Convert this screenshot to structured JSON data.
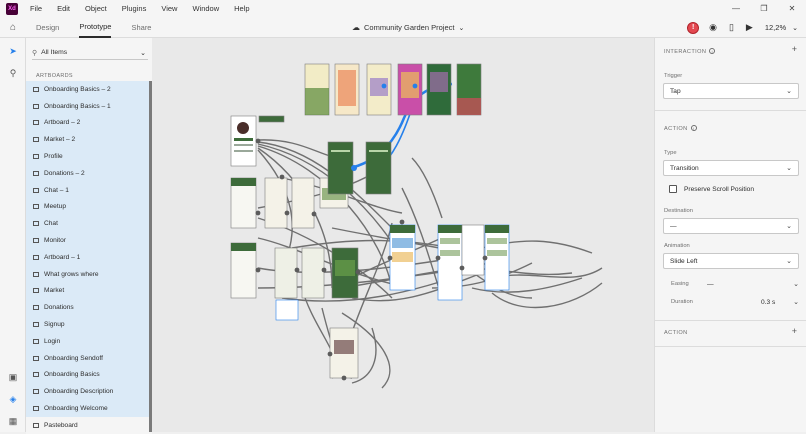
{
  "app": {
    "logo": "Xd"
  },
  "menu": [
    "File",
    "Edit",
    "Object",
    "Plugins",
    "View",
    "Window",
    "Help"
  ],
  "tabs": [
    {
      "label": "Design",
      "active": false
    },
    {
      "label": "Prototype",
      "active": true
    },
    {
      "label": "Share",
      "active": false
    }
  ],
  "document": {
    "title": "Community Garden Project"
  },
  "toolbar": {
    "alert": "!",
    "zoom": "12,2%"
  },
  "layers": {
    "filter": "All Items",
    "section": "ARTBOARDS",
    "items": [
      "Onboarding Basics – 2",
      "Onboarding Basics – 1",
      "Artboard – 2",
      "Market – 2",
      "Profile",
      "Donations – 2",
      "Chat – 1",
      "Meetup",
      "Chat",
      "Monitor",
      "Artboard – 1",
      "What grows where",
      "Market",
      "Donations",
      "Signup",
      "Login",
      "Onboarding Sendoff",
      "Onboarding Basics",
      "Onboarding Description",
      "Onboarding Welcome"
    ],
    "pasteboard": "Pasteboard"
  },
  "inspector": {
    "interaction_section": "INTERACTION",
    "trigger_label": "Trigger",
    "trigger_value": "Tap",
    "action_section": "ACTION",
    "type_label": "Type",
    "type_value": "Transition",
    "preserve_scroll": "Preserve Scroll Position",
    "destination_label": "Destination",
    "destination_value": "—",
    "animation_label": "Animation",
    "animation_value": "Slide Left",
    "easing_label": "Easing",
    "easing_value": "—",
    "duration_label": "Duration",
    "duration_value": "0.3 s",
    "action2_section": "ACTION"
  },
  "colors": {
    "accent_blue": "#2680eb",
    "wire": "#5c5c5c",
    "garden_green": "#3d6b3a",
    "selection_blue": "#dbeaf7"
  }
}
